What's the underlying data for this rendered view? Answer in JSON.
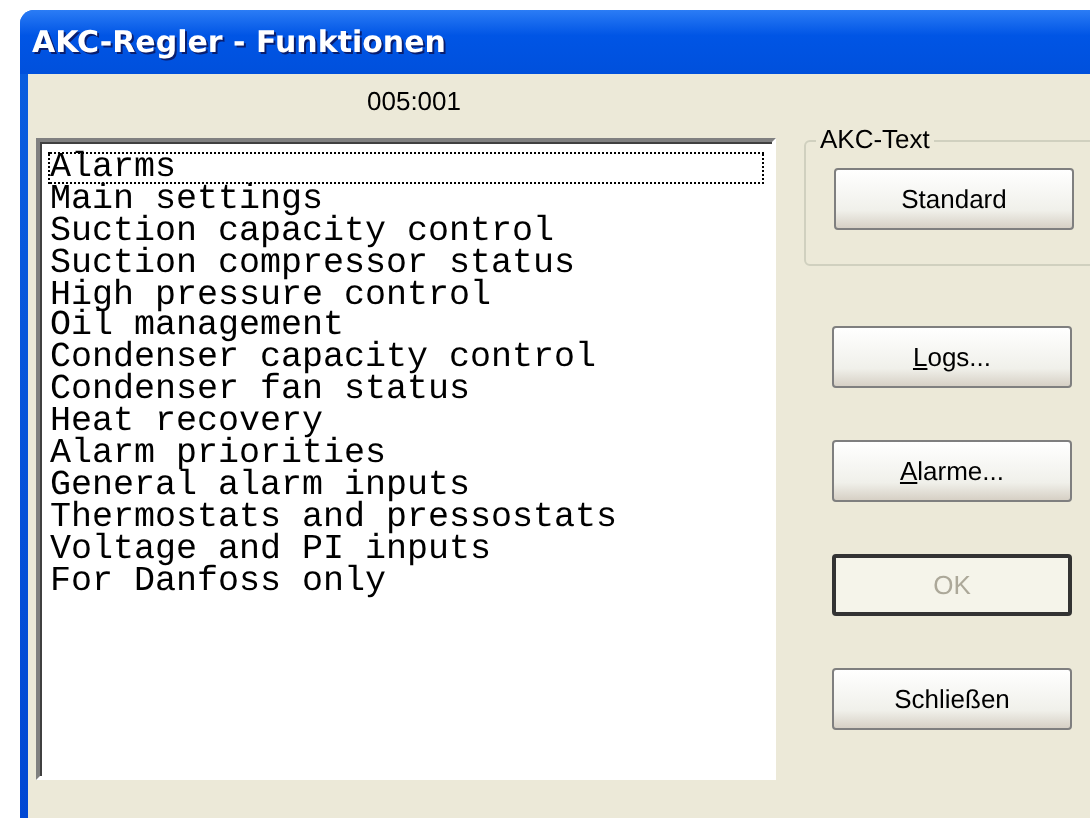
{
  "window": {
    "title": "AKC-Regler - Funktionen"
  },
  "address": "005:001",
  "list": {
    "items": [
      {
        "label": "Alarms",
        "focused": true
      },
      {
        "label": "Main settings",
        "focused": false
      },
      {
        "label": "Suction capacity control",
        "focused": false
      },
      {
        "label": "Suction compressor status",
        "focused": false
      },
      {
        "label": "High pressure control",
        "focused": false
      },
      {
        "label": "Oil management",
        "focused": false
      },
      {
        "label": "Condenser capacity control",
        "focused": false
      },
      {
        "label": "Condenser fan status",
        "focused": false
      },
      {
        "label": "Heat recovery",
        "focused": false
      },
      {
        "label": "Alarm priorities",
        "focused": false
      },
      {
        "label": "General alarm inputs",
        "focused": false
      },
      {
        "label": "Thermostats and pressostats",
        "focused": false
      },
      {
        "label": "Voltage and PI inputs",
        "focused": false
      },
      {
        "label": "For Danfoss only",
        "focused": false
      }
    ]
  },
  "akc_text_group": {
    "title": "AKC-Text",
    "button": {
      "label": "Standard",
      "disabled": false,
      "mnemonic": false
    }
  },
  "buttons": [
    {
      "label": "Logs...",
      "disabled": false,
      "mnemonic": true
    },
    {
      "label": "Alarme...",
      "disabled": false,
      "mnemonic": true
    },
    {
      "label": "OK",
      "disabled": true,
      "mnemonic": false
    },
    {
      "label": "Schließen",
      "disabled": false,
      "mnemonic": false
    }
  ]
}
